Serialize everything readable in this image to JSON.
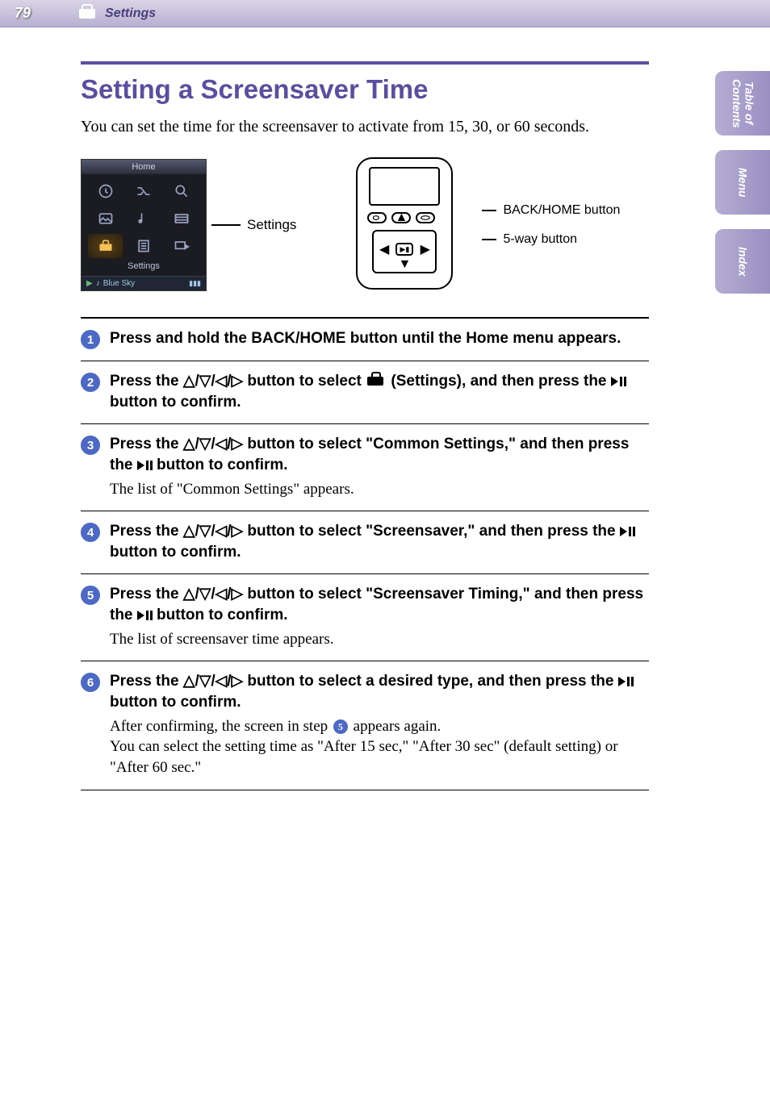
{
  "header": {
    "page_number": "79",
    "section": "Settings"
  },
  "side_tabs": [
    "Table of\nContents",
    "Menu",
    "Index"
  ],
  "title": "Setting a Screensaver Time",
  "intro": "You can set the time for the screensaver to activate from 15, 30, or 60 seconds.",
  "figure": {
    "screen": {
      "title": "Home",
      "selected_label": "Settings",
      "now_playing": "Blue Sky",
      "icons": [
        "clock-icon",
        "shuffle-icon",
        "search-icon",
        "photo-icon",
        "music-icon",
        "video-icon",
        "toolbox-icon",
        "list-icon",
        "playlist-icon"
      ]
    },
    "screen_callout": "Settings",
    "device_callouts": {
      "back_home": "BACK/HOME button",
      "five_way": "5-way button"
    }
  },
  "arrow_glyph": "△/▽/◁/▷",
  "steps": [
    {
      "num": "1",
      "bold": "Press and hold the BACK/HOME button until the Home menu appears."
    },
    {
      "num": "2",
      "bold_pre": "Press the ",
      "bold_mid": " button to select ",
      "bold_post": " (Settings), and then press the ",
      "bold_end": " button to confirm."
    },
    {
      "num": "3",
      "bold_pre": "Press the ",
      "bold_mid": " button to select \"Common Settings,\" and then press the ",
      "bold_end": " button to confirm.",
      "note": "The list of \"Common Settings\" appears."
    },
    {
      "num": "4",
      "bold_pre": "Press the ",
      "bold_mid": " button to select \"Screensaver,\" and then press the ",
      "bold_end": " button to confirm."
    },
    {
      "num": "5",
      "bold_pre": "Press the ",
      "bold_mid": " button to select \"Screensaver Timing,\" and then press the ",
      "bold_end": " button to confirm.",
      "note": "The list of screensaver time appears."
    },
    {
      "num": "6",
      "bold_pre": "Press the ",
      "bold_mid": " button to select a desired type, and then press the ",
      "bold_end": " button to confirm.",
      "note_pre": "After confirming, the screen in step ",
      "note_ref": "5",
      "note_post": " appears again.\nYou can select the setting time as \"After 15 sec,\" \"After 30 sec\" (default setting) or \"After 60 sec.\""
    }
  ]
}
